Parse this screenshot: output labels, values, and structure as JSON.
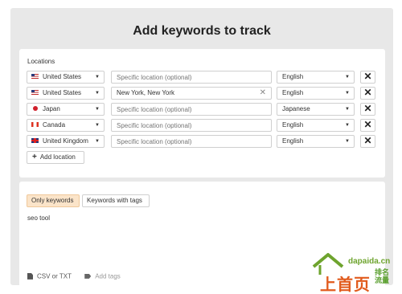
{
  "dialog": {
    "title": "Add keywords to track"
  },
  "locations": {
    "label": "Locations",
    "rows": [
      {
        "country": "United States",
        "flag": "us-flag-icon",
        "location_value": "",
        "location_placeholder": "Specific location (optional)",
        "language": "English"
      },
      {
        "country": "United States",
        "flag": "us-flag-icon",
        "location_value": "New York, New York",
        "location_placeholder": "Specific location (optional)",
        "language": "English"
      },
      {
        "country": "Japan",
        "flag": "jp-flag-icon",
        "location_value": "",
        "location_placeholder": "Specific location (optional)",
        "language": "Japanese"
      },
      {
        "country": "Canada",
        "flag": "ca-flag-icon",
        "location_value": "",
        "location_placeholder": "Specific location (optional)",
        "language": "English"
      },
      {
        "country": "United Kingdom",
        "flag": "uk-flag-icon",
        "location_value": "",
        "location_placeholder": "Specific location (optional)",
        "language": "English"
      }
    ],
    "caret_glyph": "▼",
    "remove_glyph": "✕",
    "clear_glyph": "✕",
    "add_button_label": "Add location",
    "add_glyph": "+"
  },
  "keywords": {
    "tabs": [
      {
        "label": "Only keywords",
        "active": true
      },
      {
        "label": "Keywords with tags",
        "active": false
      }
    ],
    "text": "seo tool",
    "footer": {
      "csv_label": "CSV or TXT",
      "tags_label": "Add tags"
    }
  },
  "watermark": {
    "domain": "dapaida.cn",
    "big": "上首页",
    "small_line1": "排名",
    "small_line2": "流量"
  },
  "colors": {
    "dialog_bg": "#e8e8e8",
    "active_tab_bg": "#fbe4c9",
    "watermark_green": "#6ea42e",
    "watermark_orange": "#e15b1d"
  }
}
